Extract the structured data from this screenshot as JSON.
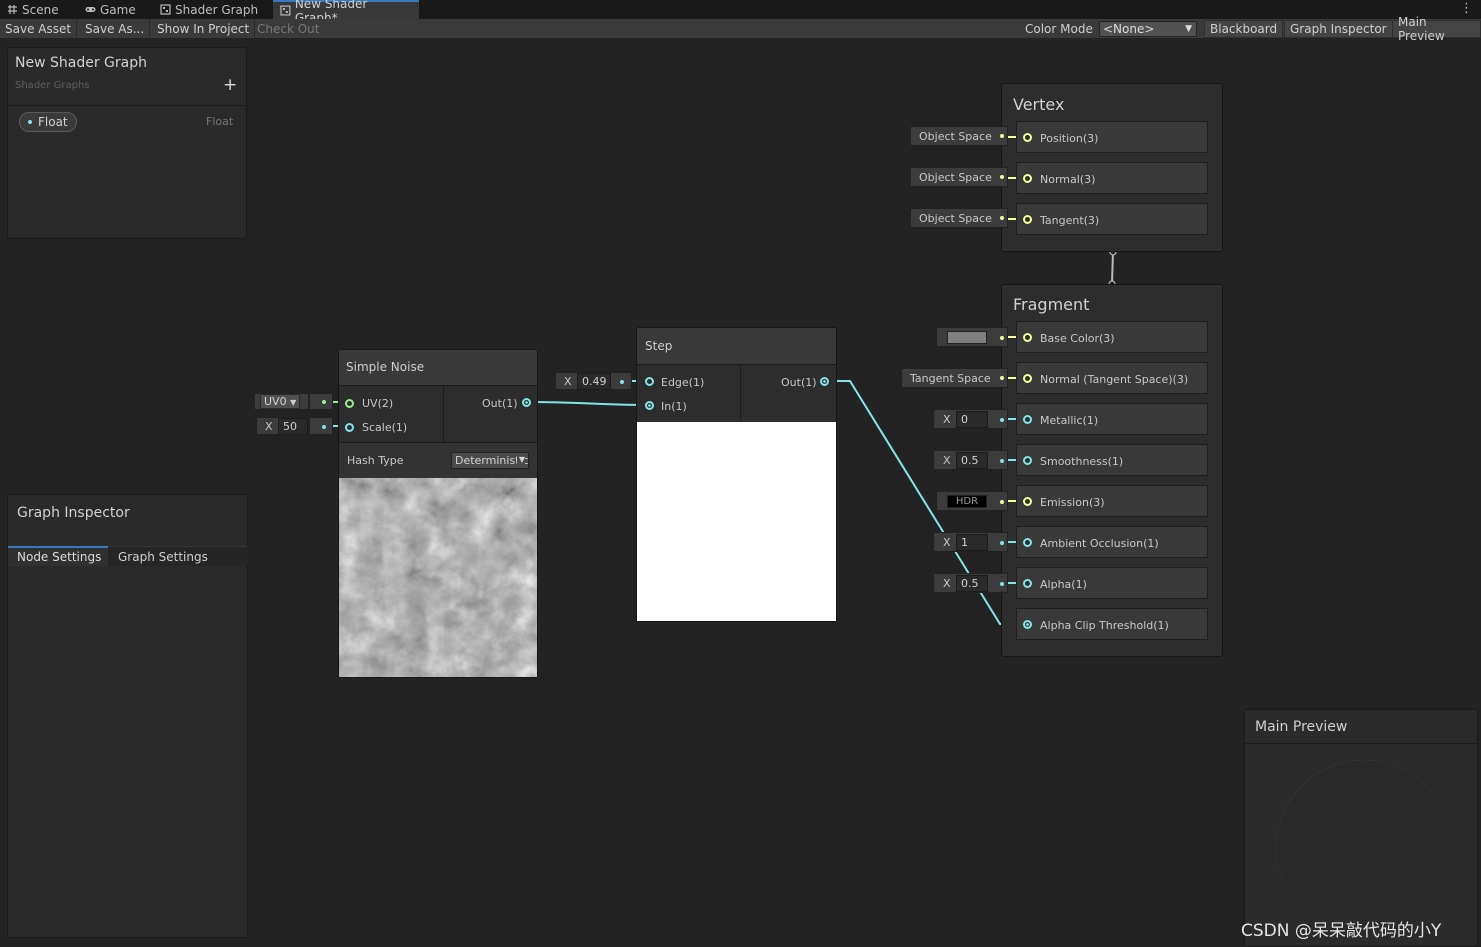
{
  "tabs": [
    {
      "label": "Scene",
      "icon": "grid-icon"
    },
    {
      "label": "Game",
      "icon": "gamepad-icon"
    },
    {
      "label": "Shader Graph",
      "icon": "shader-graph-icon"
    },
    {
      "label": "New Shader Graph*",
      "icon": "shader-graph-icon"
    }
  ],
  "toolbar": {
    "save_asset": "Save Asset",
    "save_as": "Save As...",
    "show_in_project": "Show In Project",
    "check_out": "Check Out",
    "color_mode_label": "Color Mode",
    "color_mode_value": "<None>",
    "blackboard": "Blackboard",
    "graph_inspector": "Graph Inspector",
    "main_preview": "Main Preview"
  },
  "blackboard": {
    "title": "New Shader Graph",
    "subtitle": "Shader Graphs",
    "add": "+",
    "property": {
      "name": "Float",
      "type": "Float"
    }
  },
  "inspector": {
    "title": "Graph Inspector",
    "tabs": [
      "Node Settings",
      "Graph Settings"
    ]
  },
  "simple_noise": {
    "title": "Simple Noise",
    "uv_input": "UV0",
    "uv_port": "UV(2)",
    "scale_x": "X",
    "scale_value": "50",
    "scale_port": "Scale(1)",
    "out_port": "Out(1)",
    "hash_label": "Hash Type",
    "hash_value": "Deterministic"
  },
  "step": {
    "title": "Step",
    "edge_x": "X",
    "edge_value": "0.49",
    "edge_port": "Edge(1)",
    "in_port": "In(1)",
    "out_port": "Out(1)"
  },
  "vertex": {
    "title": "Vertex",
    "ports": [
      {
        "input": "Object Space",
        "label": "Position(3)"
      },
      {
        "input": "Object Space",
        "label": "Normal(3)"
      },
      {
        "input": "Object Space",
        "label": "Tangent(3)"
      }
    ]
  },
  "fragment": {
    "title": "Fragment",
    "ports": [
      {
        "kind": "color",
        "label": "Base Color(3)",
        "color": "#808080"
      },
      {
        "kind": "text",
        "input": "Tangent Space",
        "label": "Normal (Tangent Space)(3)"
      },
      {
        "kind": "x",
        "x": "X",
        "value": "0",
        "label": "Metallic(1)"
      },
      {
        "kind": "x",
        "x": "X",
        "value": "0.5",
        "label": "Smoothness(1)"
      },
      {
        "kind": "hdr",
        "input": "HDR",
        "label": "Emission(3)"
      },
      {
        "kind": "x",
        "x": "X",
        "value": "1",
        "label": "Ambient Occlusion(1)"
      },
      {
        "kind": "x",
        "x": "X",
        "value": "0.5",
        "label": "Alpha(1)"
      },
      {
        "kind": "none",
        "label": "Alpha Clip Threshold(1)"
      }
    ]
  },
  "main_preview": {
    "title": "Main Preview"
  },
  "watermark": "CSDN @呆呆敲代码的小Y",
  "colors": {
    "vector3": "#f6ff9a",
    "float": "#84e4e7",
    "vector2": "#9aef92",
    "accent": "#3a79bb"
  },
  "more": "⋮"
}
